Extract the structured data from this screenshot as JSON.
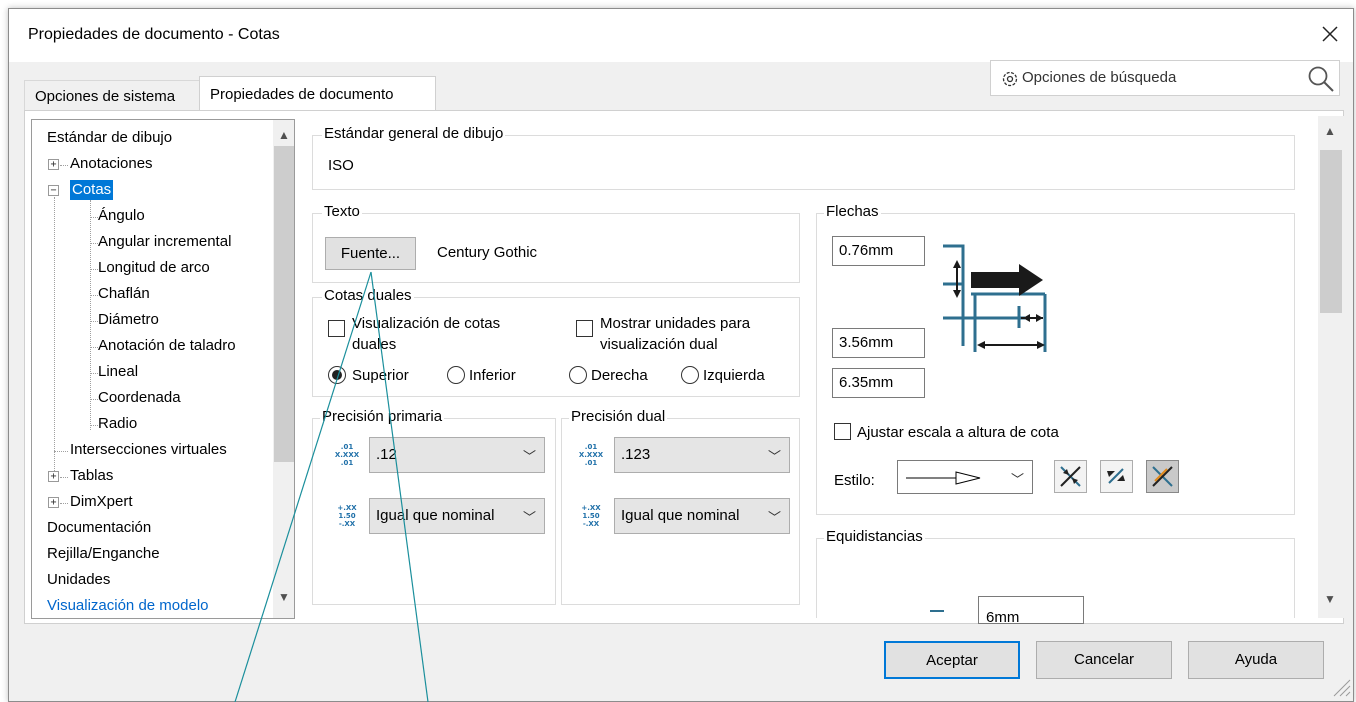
{
  "window": {
    "title": "Propiedades de documento - Cotas"
  },
  "tabs": [
    "Opciones de sistema",
    "Propiedades de documento"
  ],
  "search": {
    "placeholder": "Opciones de búsqueda"
  },
  "tree": {
    "items": [
      "Estándar de dibujo",
      "Anotaciones",
      "Cotas",
      "Ángulo",
      "Angular incremental",
      "Longitud de arco",
      "Chaflán",
      "Diámetro",
      "Anotación de taladro",
      "Lineal",
      "Coordenada",
      "Radio",
      "Intersecciones virtuales",
      "Tablas",
      "DimXpert",
      "Documentación",
      "Rejilla/Enganche",
      "Unidades",
      "Visualización de modelo"
    ],
    "selected": "Cotas"
  },
  "standard": {
    "label": "Estándar general de dibujo",
    "value": "ISO"
  },
  "text": {
    "label": "Texto",
    "font_button": "Fuente...",
    "font_name": "Century Gothic"
  },
  "dual": {
    "label": "Cotas duales",
    "show_dual": "Visualización de cotas duales",
    "show_units": "Mostrar unidades para visualización dual",
    "radio_superior": "Superior",
    "radio_inferior": "Inferior",
    "radio_derecha": "Derecha",
    "radio_izquierda": "Izquierda"
  },
  "precision_primary": {
    "label": "Precisión primaria",
    "value": ".12",
    "tolerance": "Igual que nominal"
  },
  "precision_dual": {
    "label": "Precisión dual",
    "value": ".123",
    "tolerance": "Igual que nominal"
  },
  "precision_icons": {
    "top_a": ".01",
    "top_b": "X.XXX",
    "top_c": ".01",
    "bot_a": "+.XX",
    "bot_b": "1.50",
    "bot_c": "-.XX"
  },
  "arrows": {
    "label": "Flechas",
    "size1": "0.76mm",
    "size2": "3.56mm",
    "size3": "6.35mm",
    "scale_label": "Ajustar escala a altura de cota",
    "style_label": "Estilo:"
  },
  "offsets": {
    "label": "Equidistancias",
    "value": "6mm"
  },
  "buttons": {
    "ok": "Aceptar",
    "cancel": "Cancelar",
    "help": "Ayuda"
  },
  "colors": {
    "accent": "#0078d7",
    "diagram_blue": "#2e6f8f",
    "selection": "#0078d7"
  }
}
